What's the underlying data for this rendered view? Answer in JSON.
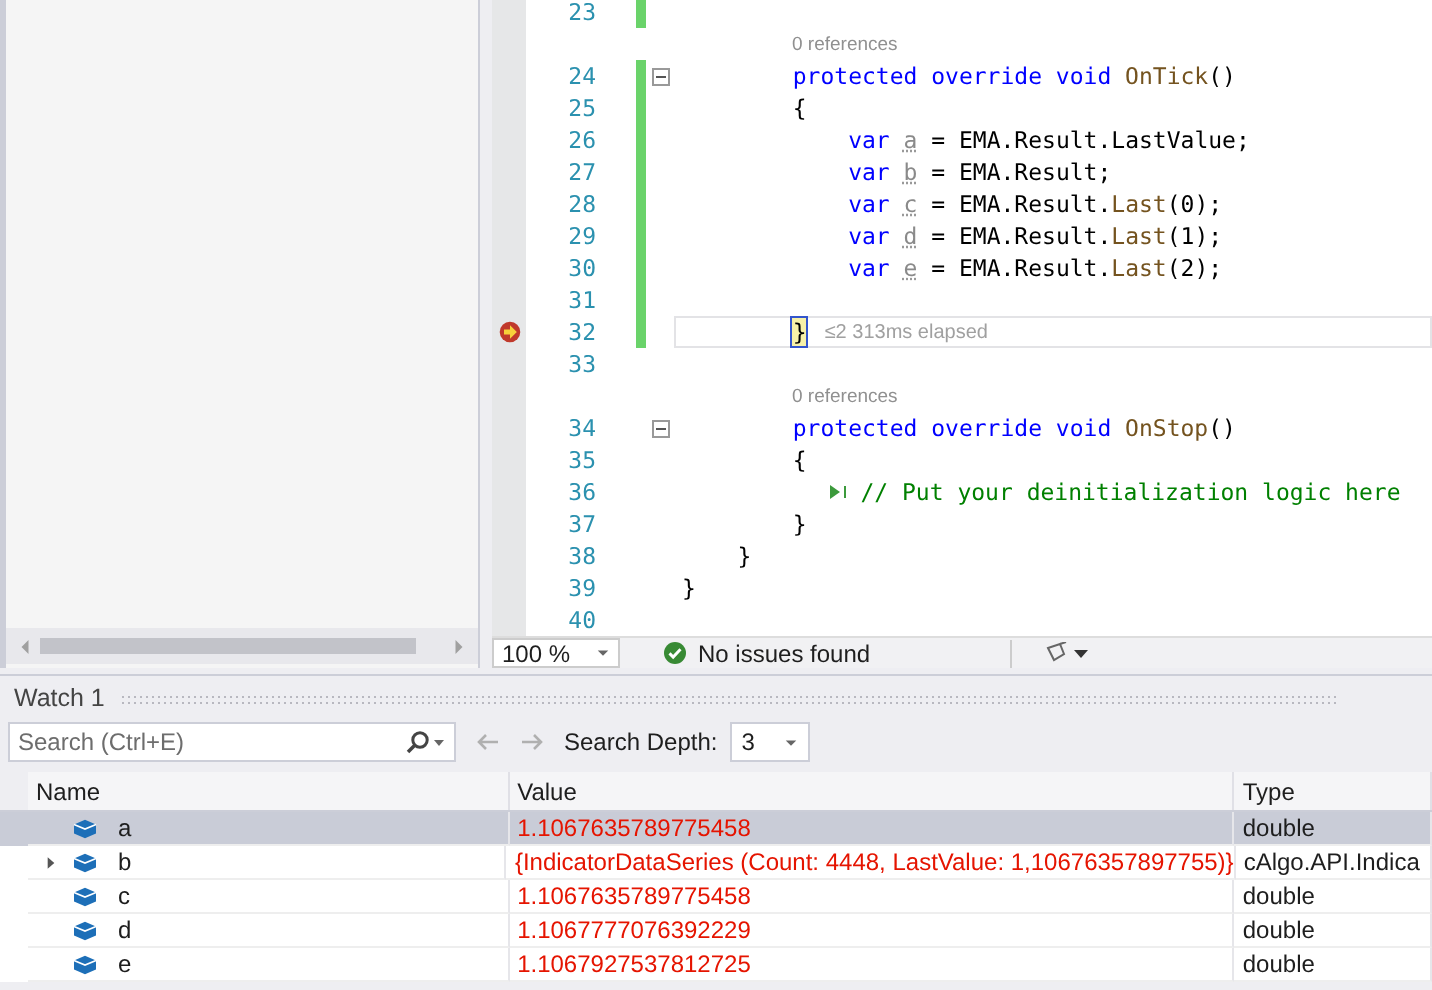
{
  "editor": {
    "lines": [
      {
        "kind": "code",
        "number": "23",
        "changed": true,
        "fold": false,
        "current": false,
        "run_to_click": false
      },
      {
        "kind": "references",
        "text": "0 references"
      },
      {
        "kind": "code",
        "number": "24",
        "changed": true,
        "fold": true,
        "current": false,
        "run_to_click": false,
        "tokens": [
          {
            "text": "        protected override void ",
            "kind": "keyword"
          },
          {
            "text": "OnTick",
            "kind": "method"
          },
          {
            "text": "()",
            "kind": "plain"
          }
        ]
      },
      {
        "kind": "code",
        "number": "25",
        "changed": true,
        "fold": false,
        "current": false,
        "run_to_click": false,
        "tokens": [
          {
            "text": "        {",
            "kind": "plain"
          }
        ]
      },
      {
        "kind": "code",
        "number": "26",
        "changed": true,
        "fold": false,
        "current": false,
        "run_to_click": false,
        "tokens": [
          {
            "text": "            var ",
            "kind": "keyword"
          },
          {
            "text": "a",
            "kind": "unused"
          },
          {
            "text": " = EMA.Result.LastValue;",
            "kind": "plain"
          }
        ]
      },
      {
        "kind": "code",
        "number": "27",
        "changed": true,
        "fold": false,
        "current": false,
        "run_to_click": false,
        "tokens": [
          {
            "text": "            var ",
            "kind": "keyword"
          },
          {
            "text": "b",
            "kind": "unused"
          },
          {
            "text": " = EMA.Result;",
            "kind": "plain"
          }
        ]
      },
      {
        "kind": "code",
        "number": "28",
        "changed": true,
        "fold": false,
        "current": false,
        "run_to_click": false,
        "tokens": [
          {
            "text": "            var ",
            "kind": "keyword"
          },
          {
            "text": "c",
            "kind": "unused"
          },
          {
            "text": " = EMA.Result.",
            "kind": "plain"
          },
          {
            "text": "Last",
            "kind": "method"
          },
          {
            "text": "(0);",
            "kind": "plain"
          }
        ]
      },
      {
        "kind": "code",
        "number": "29",
        "changed": true,
        "fold": false,
        "current": false,
        "run_to_click": false,
        "tokens": [
          {
            "text": "            var ",
            "kind": "keyword"
          },
          {
            "text": "d",
            "kind": "unused"
          },
          {
            "text": " = EMA.Result.",
            "kind": "plain"
          },
          {
            "text": "Last",
            "kind": "method"
          },
          {
            "text": "(1);",
            "kind": "plain"
          }
        ]
      },
      {
        "kind": "code",
        "number": "30",
        "changed": true,
        "fold": false,
        "current": false,
        "run_to_click": false,
        "tokens": [
          {
            "text": "            var ",
            "kind": "keyword"
          },
          {
            "text": "e",
            "kind": "unused"
          },
          {
            "text": " = EMA.Result.",
            "kind": "plain"
          },
          {
            "text": "Last",
            "kind": "method"
          },
          {
            "text": "(2);",
            "kind": "plain"
          }
        ]
      },
      {
        "kind": "code",
        "number": "31",
        "changed": true,
        "fold": false,
        "current": false,
        "run_to_click": false
      },
      {
        "kind": "code",
        "number": "32",
        "changed": true,
        "fold": false,
        "current": true,
        "run_to_click": false,
        "tokens": [
          {
            "text": "        }",
            "kind": "brace-match"
          }
        ],
        "hint": "≤2 313ms elapsed"
      },
      {
        "kind": "code",
        "number": "33",
        "changed": false,
        "fold": false,
        "current": false,
        "run_to_click": false
      },
      {
        "kind": "references",
        "text": "0 references"
      },
      {
        "kind": "code",
        "number": "34",
        "changed": false,
        "fold": true,
        "current": false,
        "run_to_click": false,
        "tokens": [
          {
            "text": "        protected override void ",
            "kind": "keyword"
          },
          {
            "text": "OnStop",
            "kind": "method"
          },
          {
            "text": "()",
            "kind": "plain"
          }
        ]
      },
      {
        "kind": "code",
        "number": "35",
        "changed": false,
        "fold": false,
        "current": false,
        "run_to_click": false,
        "tokens": [
          {
            "text": "        {",
            "kind": "plain"
          }
        ]
      },
      {
        "kind": "code",
        "number": "36",
        "changed": false,
        "fold": false,
        "current": false,
        "run_to_click": true,
        "tokens": [
          {
            "text": "            // Put your deinitialization logic here",
            "kind": "comment"
          }
        ]
      },
      {
        "kind": "code",
        "number": "37",
        "changed": false,
        "fold": false,
        "current": false,
        "run_to_click": false,
        "tokens": [
          {
            "text": "        }",
            "kind": "plain"
          }
        ]
      },
      {
        "kind": "code",
        "number": "38",
        "changed": false,
        "fold": false,
        "current": false,
        "run_to_click": false,
        "tokens": [
          {
            "text": "    }",
            "kind": "plain"
          }
        ]
      },
      {
        "kind": "code",
        "number": "39",
        "changed": false,
        "fold": false,
        "current": false,
        "run_to_click": false,
        "tokens": [
          {
            "text": "}",
            "kind": "plain"
          }
        ]
      },
      {
        "kind": "code",
        "number": "40",
        "changed": false,
        "fold": false,
        "current": false,
        "run_to_click": false
      }
    ],
    "zoom": "100 %",
    "issues": "No issues found"
  },
  "watch": {
    "title": "Watch 1",
    "search": {
      "placeholder": "Search (Ctrl+E)"
    },
    "depth_label": "Search Depth:",
    "depth_value": "3",
    "columns": [
      "Name",
      "Value",
      "Type"
    ],
    "rows": [
      {
        "name": "a",
        "value": "1.1067635789775458",
        "type": "double",
        "expandable": false,
        "selected": true,
        "changed": true
      },
      {
        "name": "b",
        "value": "{IndicatorDataSeries (Count: 4448, LastValue: 1,10676357897755)}",
        "type": "cAlgo.API.Indica",
        "expandable": true,
        "selected": false,
        "changed": true
      },
      {
        "name": "c",
        "value": "1.1067635789775458",
        "type": "double",
        "expandable": false,
        "selected": false,
        "changed": true
      },
      {
        "name": "d",
        "value": "1.1067777076392229",
        "type": "double",
        "expandable": false,
        "selected": false,
        "changed": true
      },
      {
        "name": "e",
        "value": "1.1067927537812725",
        "type": "double",
        "expandable": false,
        "selected": false,
        "changed": true
      }
    ]
  }
}
